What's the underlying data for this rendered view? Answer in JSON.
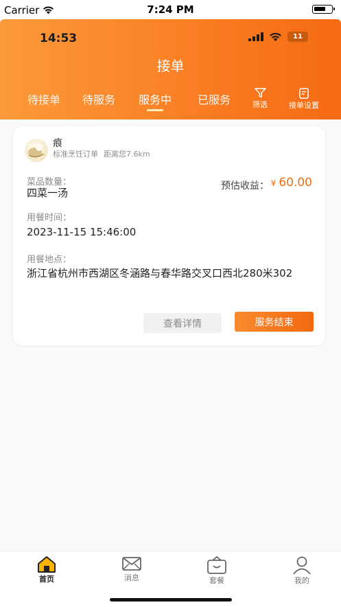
{
  "sim_status": {
    "carrier": "Carrier",
    "time": "7:24 PM"
  },
  "app_status": {
    "time": "14:53",
    "battery": "11"
  },
  "header": {
    "title": "接单"
  },
  "tabs": [
    {
      "label": "待接单"
    },
    {
      "label": "待服务"
    },
    {
      "label": "服务中",
      "active": true
    },
    {
      "label": "已服务"
    }
  ],
  "tools": {
    "filter_label": "筛选",
    "settings_label": "接单设置"
  },
  "order": {
    "user_name": "痕",
    "order_type": "标准烹饪订单",
    "distance": "距离您7.6km",
    "dish_count_label": "菜品数量：",
    "dish_count_value": "四菜一汤",
    "income_label": "预估收益：",
    "currency": "¥",
    "income_value": "60.00",
    "meal_time_label": "用餐时间：",
    "meal_time_value": "2023-11-15 15:46:00",
    "address_label": "用餐地点：",
    "address_value": "浙江省杭州市西湖区冬涵路与春华路交叉口西北280米302",
    "detail_button": "查看详情",
    "finish_button": "服务结束"
  },
  "tabbar": [
    {
      "label": "首页",
      "icon": "home-icon",
      "active": true
    },
    {
      "label": "消息",
      "icon": "message-icon"
    },
    {
      "label": "套餐",
      "icon": "package-icon"
    },
    {
      "label": "我的",
      "icon": "profile-icon"
    }
  ],
  "colors": {
    "accent": "#f56a12",
    "header_start": "#fb9a3a",
    "income": "#f06b12"
  }
}
